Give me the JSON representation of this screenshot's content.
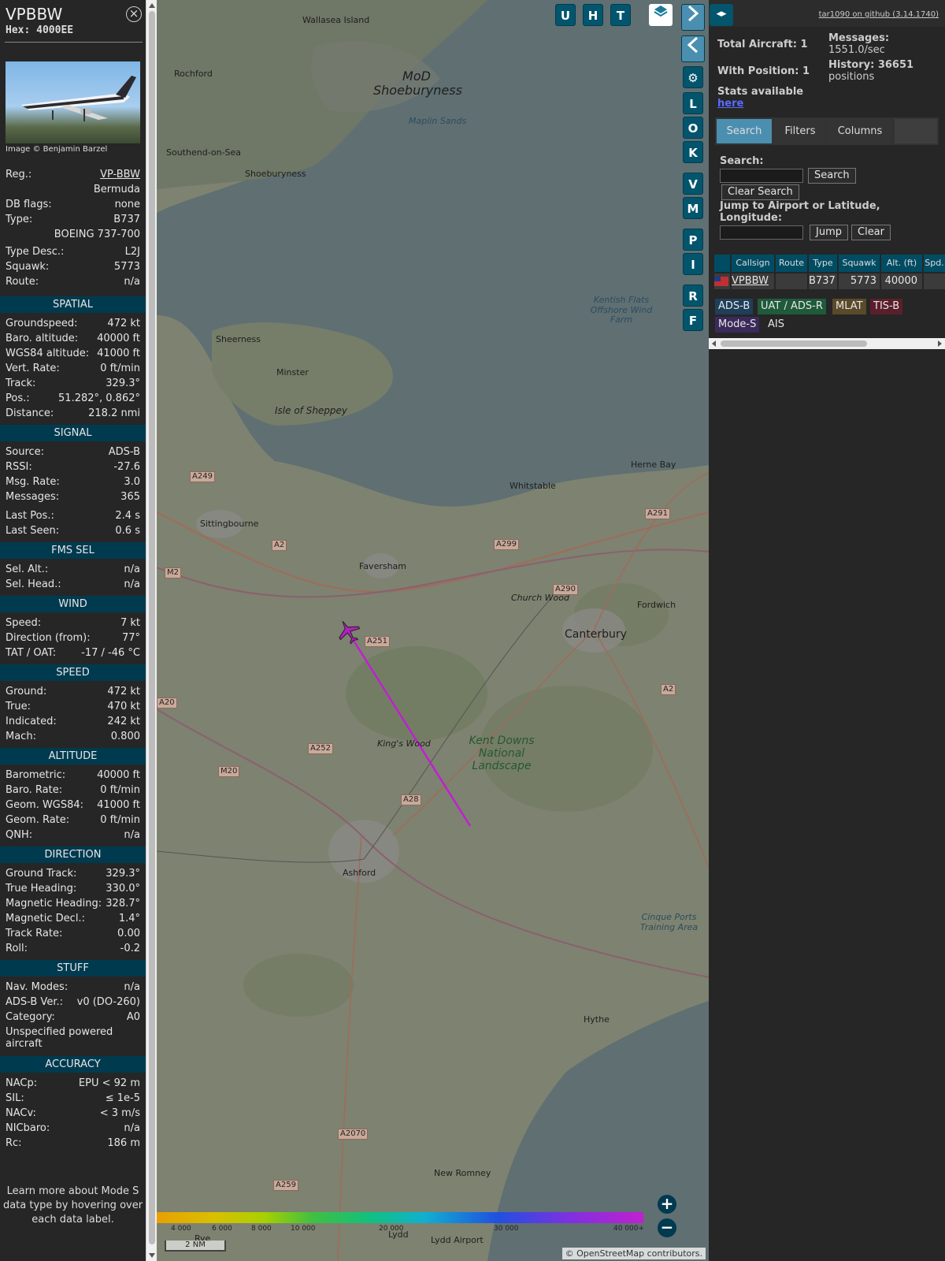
{
  "sidebar": {
    "callsign": "VPBBW",
    "hex": "Hex: 4000EE",
    "photo_credit": "Image © Benjamin Barzel",
    "info": [
      {
        "k": "Reg.:",
        "v": "VP-BBW"
      },
      {
        "k": "",
        "v": "Bermuda"
      },
      {
        "k": "DB flags:",
        "v": "none"
      },
      {
        "k": "Type:",
        "v": "B737"
      },
      {
        "k": "",
        "v": "BOEING 737-700"
      },
      {
        "k": "Type Desc.:",
        "v": "L2J"
      },
      {
        "k": "Squawk:",
        "v": "5773"
      },
      {
        "k": "Route:",
        "v": "n/a"
      }
    ],
    "sections": {
      "spatial": {
        "title": "SPATIAL",
        "rows": [
          {
            "k": "Groundspeed:",
            "v": "472 kt"
          },
          {
            "k": "Baro. altitude:",
            "v": "40000 ft"
          },
          {
            "k": "WGS84 altitude:",
            "v": "41000 ft"
          },
          {
            "k": "Vert. Rate:",
            "v": "0 ft/min"
          },
          {
            "k": "Track:",
            "v": "329.3°"
          },
          {
            "k": "Pos.:",
            "v": "51.282°, 0.862°"
          },
          {
            "k": "Distance:",
            "v": "218.2 nmi"
          }
        ]
      },
      "signal": {
        "title": "SIGNAL",
        "rows": [
          {
            "k": "Source:",
            "v": "ADS-B"
          },
          {
            "k": "RSSI:",
            "v": "-27.6"
          },
          {
            "k": "Msg. Rate:",
            "v": "3.0"
          },
          {
            "k": "Messages:",
            "v": "365"
          },
          {
            "k": "Last Pos.:",
            "v": "2.4 s"
          },
          {
            "k": "Last Seen:",
            "v": "0.6 s"
          }
        ]
      },
      "fms": {
        "title": "FMS SEL",
        "rows": [
          {
            "k": "Sel. Alt.:",
            "v": "n/a"
          },
          {
            "k": "Sel. Head.:",
            "v": "n/a"
          }
        ]
      },
      "wind": {
        "title": "WIND",
        "rows": [
          {
            "k": "Speed:",
            "v": "7 kt"
          },
          {
            "k": "Direction (from):",
            "v": "77°"
          },
          {
            "k": "TAT / OAT:",
            "v": "-17 / -46 °C"
          }
        ]
      },
      "speed": {
        "title": "SPEED",
        "rows": [
          {
            "k": "Ground:",
            "v": "472 kt"
          },
          {
            "k": "True:",
            "v": "470 kt"
          },
          {
            "k": "Indicated:",
            "v": "242 kt"
          },
          {
            "k": "Mach:",
            "v": "0.800"
          }
        ]
      },
      "altitude": {
        "title": "ALTITUDE",
        "rows": [
          {
            "k": "Barometric:",
            "v": "40000 ft"
          },
          {
            "k": "Baro. Rate:",
            "v": "0 ft/min"
          },
          {
            "k": "Geom. WGS84:",
            "v": "41000 ft"
          },
          {
            "k": "Geom. Rate:",
            "v": "0 ft/min"
          },
          {
            "k": "QNH:",
            "v": "n/a"
          }
        ]
      },
      "direction": {
        "title": "DIRECTION",
        "rows": [
          {
            "k": "Ground Track:",
            "v": "329.3°"
          },
          {
            "k": "True Heading:",
            "v": "330.0°"
          },
          {
            "k": "Magnetic Heading:",
            "v": "328.7°"
          },
          {
            "k": "Magnetic Decl.:",
            "v": "1.4°"
          },
          {
            "k": "Track Rate:",
            "v": "0.00"
          },
          {
            "k": "Roll:",
            "v": "-0.2"
          }
        ]
      },
      "stuff": {
        "title": "STUFF",
        "rows": [
          {
            "k": "Nav. Modes:",
            "v": "n/a"
          },
          {
            "k": "ADS-B Ver.:",
            "v": "v0 (DO-260)"
          },
          {
            "k": "Category:",
            "v": "A0"
          }
        ],
        "category_desc": "Unspecified powered aircraft"
      },
      "accuracy": {
        "title": "ACCURACY",
        "rows": [
          {
            "k": "NACp:",
            "v": "EPU < 92 m"
          },
          {
            "k": "SIL:",
            "v": "≤ 1e-5"
          },
          {
            "k": "NACv:",
            "v": "< 3 m/s"
          },
          {
            "k": "NICbaro:",
            "v": "n/a"
          },
          {
            "k": "Rc:",
            "v": "186 m"
          }
        ]
      }
    },
    "footer_note": "Learn more about Mode S data type by hovering over each data label."
  },
  "map": {
    "buttons_top": [
      "U",
      "H",
      "T"
    ],
    "buttons_side": [
      "L",
      "O",
      "K",
      "V",
      "M",
      "P",
      "I",
      "R",
      "F"
    ],
    "places": [
      "Wallasea Island",
      "MoD Shoeburyness",
      "Rochford",
      "Southend-on-Sea",
      "Shoeburyness",
      "Maplin Sands",
      "Kentish Flats Offshore Wind Farm",
      "Sheerness",
      "Minster",
      "Isle of Sheppey",
      "Herne Bay",
      "Whitstable",
      "Sittingbourne",
      "Faversham",
      "Church Wood",
      "Fordwich",
      "Canterbury",
      "Kent Downs National Landscape",
      "King's Wood",
      "Ashford",
      "Cinque Ports Training Area",
      "Hythe",
      "New Romney",
      "Lydd",
      "Lydd Airport",
      "Rye"
    ],
    "roads": [
      "A249",
      "A2",
      "M2",
      "A299",
      "A291",
      "A290",
      "A251",
      "A20",
      "A252",
      "M20",
      "A28",
      "A2070",
      "A259",
      "A2"
    ],
    "colorbar_ticks": [
      "4 000",
      "6 000",
      "8 000",
      "10 000",
      "20 000",
      "30 000",
      "40 000+"
    ],
    "scale": "2 NM",
    "attribution": "© OpenStreetMap contributors."
  },
  "panel": {
    "github": "tar1090 on github (3.14.1740)",
    "total_aircraft": "Total Aircraft: 1",
    "with_position": "With Position: 1",
    "messages_label": "Messages:",
    "messages_value": "1551.0/sec",
    "history_label": "History: 36651",
    "history_value": "positions",
    "stats_label": "Stats available",
    "stats_link": "here",
    "tabs": [
      "Search",
      "Filters",
      "Columns"
    ],
    "search_label": "Search:",
    "search_button": "Search",
    "clear_search_button": "Clear Search",
    "jump_label": "Jump to Airport or Latitude, Longitude:",
    "jump_button": "Jump",
    "clear_button": "Clear",
    "table_headers": [
      "Callsign",
      "Route",
      "Type",
      "Squawk",
      "Alt. (ft)",
      "Spd."
    ],
    "table_row": {
      "callsign": "VPBBW",
      "route": "",
      "type": "B737",
      "squawk": "5773",
      "alt": "40000"
    },
    "badges": [
      "ADS-B",
      "UAT / ADS-R",
      "MLAT",
      "TIS-B",
      "Mode-S",
      "AIS"
    ],
    "colors": {
      "ads_b": "#1f3e5a",
      "uat": "#1f5a3a",
      "mlat": "#5a4a2a",
      "tisb": "#5a1f2a",
      "modes": "#3a2a5a"
    }
  }
}
